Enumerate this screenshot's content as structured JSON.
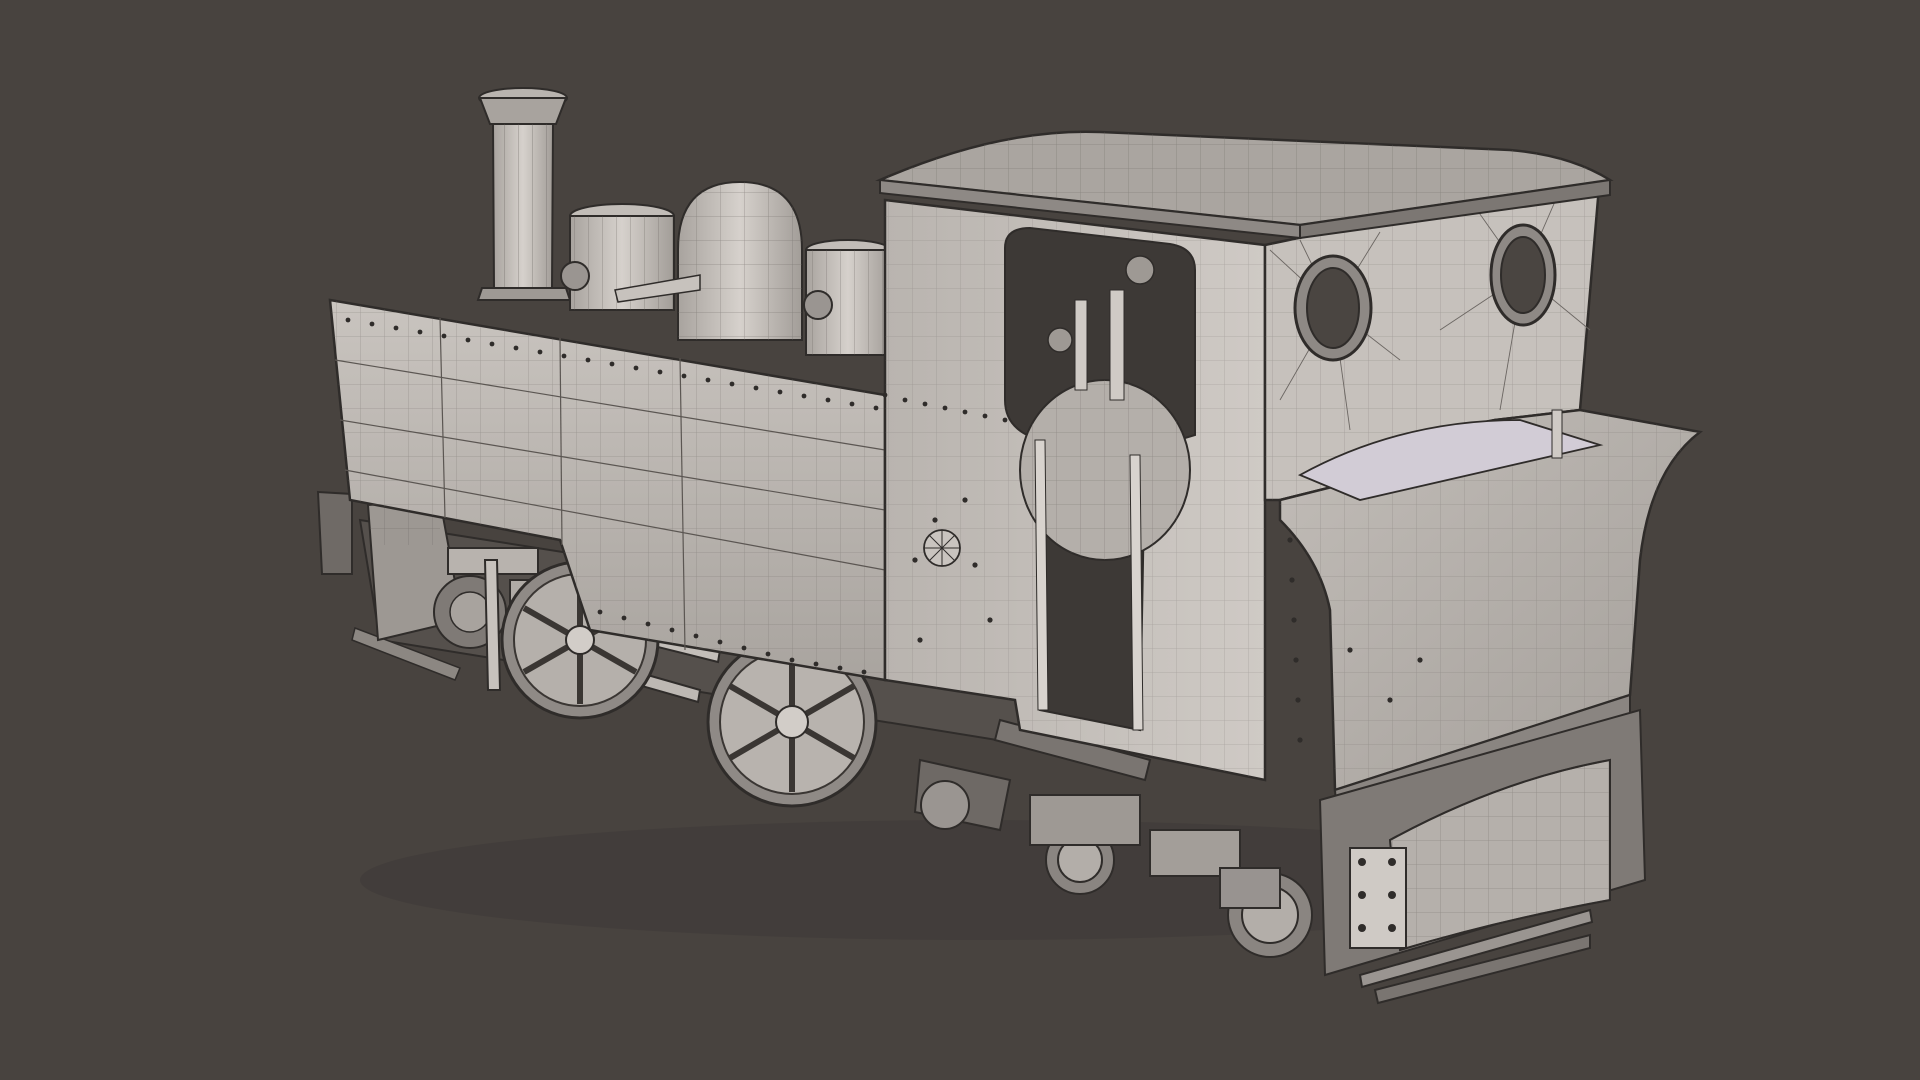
{
  "viewport": {
    "background_color": "#48433f",
    "shading": "solid-with-wireframe",
    "model_color": "#bdb8b3",
    "wire_color": "#3a3633"
  },
  "subject": {
    "name": "steam-tank-locomotive-3d-model",
    "parts": [
      "chimney",
      "sand-box-front",
      "steam-dome",
      "sand-box-rear",
      "side-tank",
      "cab",
      "cab-roof",
      "spectacle-window-left",
      "spectacle-window-right",
      "firebox-backhead",
      "coal-bunker",
      "rear-buffer-beam",
      "front-cylinder",
      "valve-gear",
      "driving-wheel-front",
      "driving-wheel-rear",
      "trailing-truck"
    ]
  }
}
